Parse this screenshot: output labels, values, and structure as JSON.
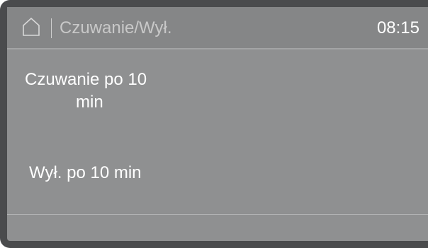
{
  "header": {
    "title": "Czuwanie/Wył.",
    "time": "08:15",
    "home_icon": "home-icon"
  },
  "options": [
    {
      "line1": "Czuwanie po 10",
      "line2": "min"
    },
    {
      "label": "Wył. po 10 min"
    }
  ],
  "colors": {
    "screen_bg": "#8f9091",
    "header_bg": "#858687",
    "bezel": "#4a4b4d",
    "text": "#ffffff",
    "title_text": "#c8c8c8"
  }
}
